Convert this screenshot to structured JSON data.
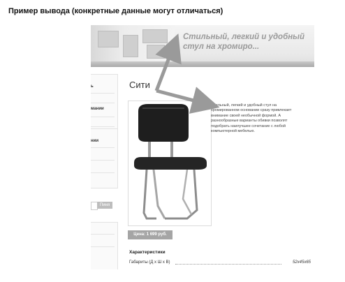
{
  "caption": "Пример вывода (конкретные данные могут отличаться)",
  "banner": {
    "text": "Стильный, легкий и удобный стул на хромиро..."
  },
  "sidebar": {
    "block1": {
      "title": "ь",
      "sub": "мании"
    },
    "block2": {
      "title": "нии"
    },
    "search_button": "Пиня"
  },
  "product": {
    "title": "Сити",
    "description": "Стильный, легкий и удобный стул на хромированном основании сразу привлекает внимание своей необычной формой. А разнообразные варианты обивки позволят подобрать наилучшее сочетание с любой компьютерной мебелью.",
    "price": "Цена: 1 699 руб.",
    "specs_title": "Характеристики",
    "specs": [
      {
        "label": "Габариты (Д х Ш х В)",
        "value": "52x45x65"
      }
    ]
  },
  "colors": {
    "arrow": "#9a9a9a",
    "price_bg": "#a5a5a5"
  }
}
